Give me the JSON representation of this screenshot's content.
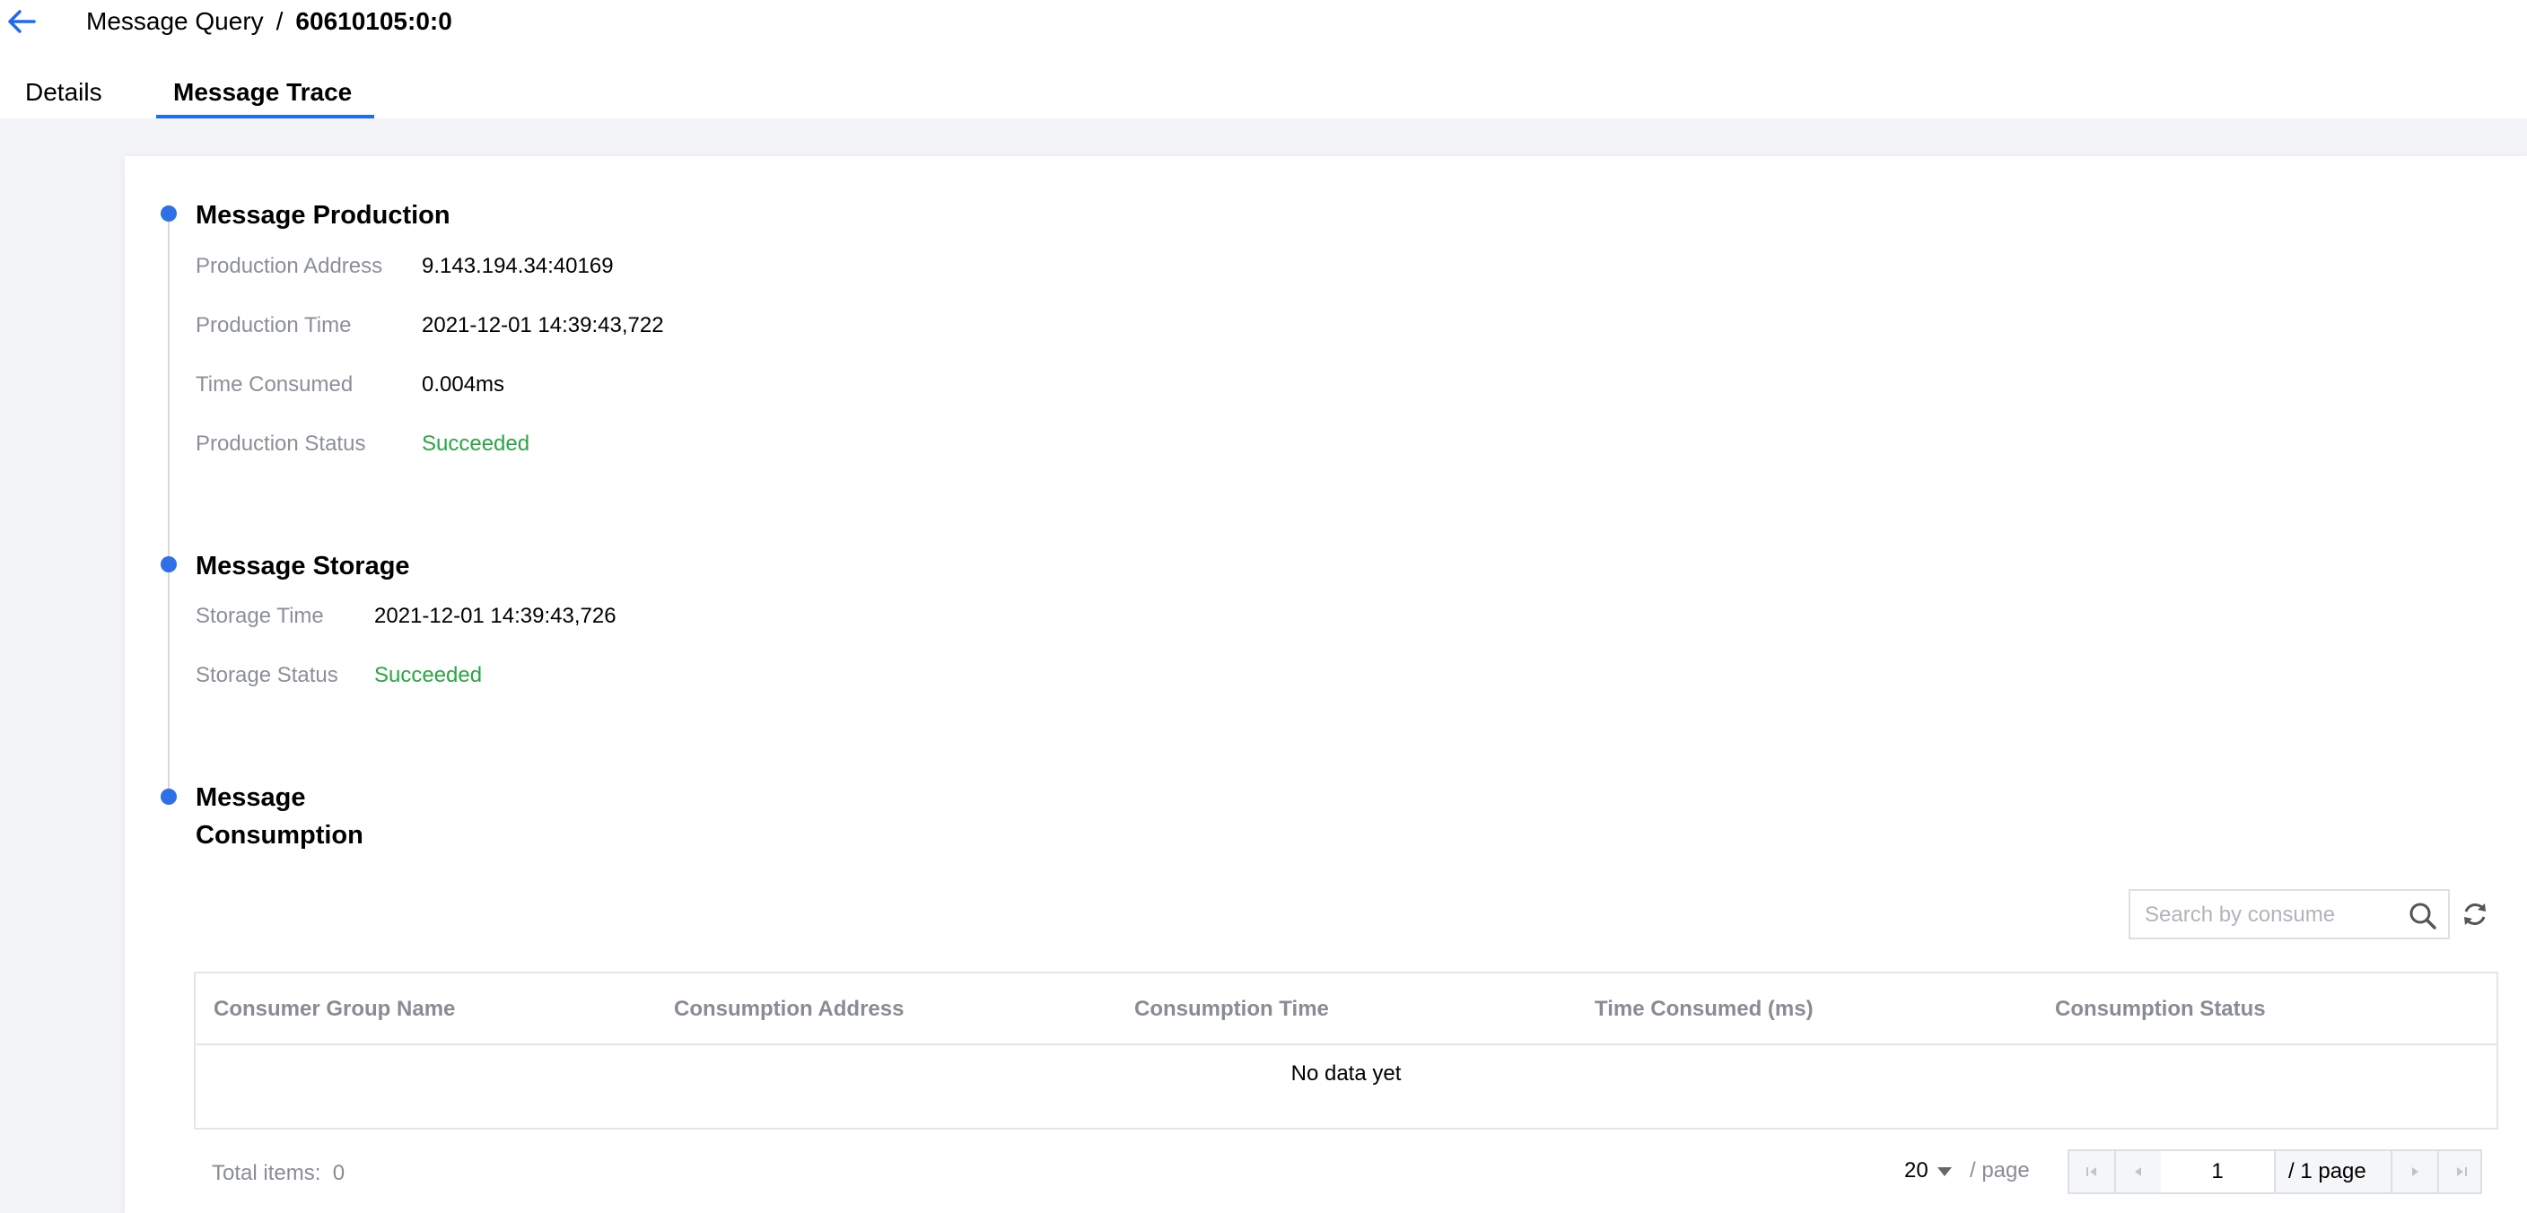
{
  "header": {
    "breadcrumb_parent": "Message Query",
    "breadcrumb_separator": "/",
    "breadcrumb_current": "60610105:0:0"
  },
  "tabs": [
    {
      "label": "Details",
      "active": false
    },
    {
      "label": "Message Trace",
      "active": true
    }
  ],
  "production": {
    "title": "Message Production",
    "rows": [
      {
        "label": "Production Address",
        "value": "9.143.194.34:40169"
      },
      {
        "label": "Production Time",
        "value": "2021-12-01 14:39:43,722"
      },
      {
        "label": "Time Consumed",
        "value": "0.004ms"
      },
      {
        "label": "Production Status",
        "value": "Succeeded"
      }
    ]
  },
  "storage": {
    "title": "Message Storage",
    "rows": [
      {
        "label": "Storage Time",
        "value": "2021-12-01 14:39:43,726"
      },
      {
        "label": "Storage Status",
        "value": "Succeeded"
      }
    ]
  },
  "consumption": {
    "title_line1": "Message",
    "title_line2": "Consumption",
    "search_placeholder": "Search by consume",
    "columns": [
      "Consumer Group Name",
      "Consumption Address",
      "Consumption Time",
      "Time Consumed (ms)",
      "Consumption Status"
    ],
    "rows": [],
    "empty_text": "No data yet"
  },
  "pagination": {
    "total_label": "Total items:",
    "total_count": "0",
    "page_size": "20",
    "per_page_label": "/ page",
    "current_page": "1",
    "page_of": "/ 1 page"
  },
  "colors": {
    "accent": "#1f6cf0",
    "success": "#29a744",
    "label_gray": "#8a8f99"
  },
  "icons": [
    "back-arrow-icon",
    "search-icon",
    "refresh-icon",
    "first-page-icon",
    "prev-page-icon",
    "next-page-icon",
    "last-page-icon"
  ]
}
